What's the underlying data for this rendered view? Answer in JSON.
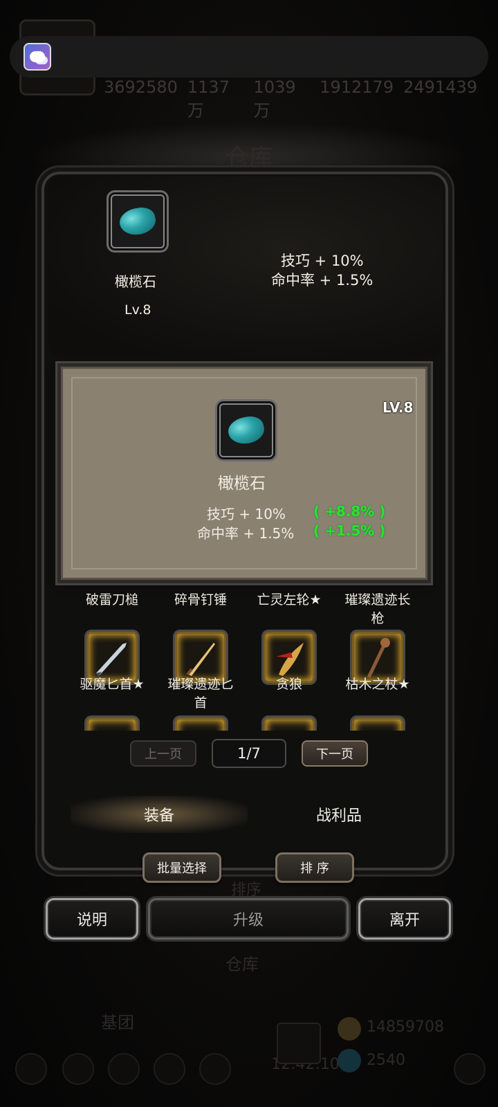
{
  "background": {
    "stats": [
      "3692580",
      "1137万",
      "1039万",
      "1912179",
      "2491439"
    ],
    "title": "仓库",
    "under_sort": "排序",
    "under_title": "仓库",
    "guild": "基团",
    "resources": [
      "14859708",
      "2540"
    ],
    "clock": "12:42:10"
  },
  "item": {
    "name": "橄榄石",
    "level": "Lv.8",
    "stats": [
      "技巧 + 10%",
      "命中率 + 1.5%"
    ]
  },
  "popup": {
    "level": "LV.8",
    "name": "橄榄石",
    "stats": [
      "技巧 + 10%",
      "命中率 + 1.5%"
    ],
    "bonuses": [
      "( +8.8% )",
      "( +1.5% )"
    ]
  },
  "grid": {
    "top_row_labels": [
      "破雷刀槌",
      "碎骨钉锤",
      "亡灵左轮★",
      "璀璨遗迹长",
      "枪"
    ],
    "row2_line1": [
      "驱魔匕首★",
      "璀璨遗迹匕",
      "贪狼",
      "枯木之杖★"
    ],
    "row2_line2": "首"
  },
  "paging": {
    "prev": "上一页",
    "page": "1/7",
    "next": "下一页"
  },
  "tabs": {
    "equipment": "装备",
    "loot": "战利品"
  },
  "actions": {
    "batch_select": "批量选择",
    "sort": "排 序",
    "help": "说明",
    "upgrade": "升级",
    "leave": "离开"
  }
}
